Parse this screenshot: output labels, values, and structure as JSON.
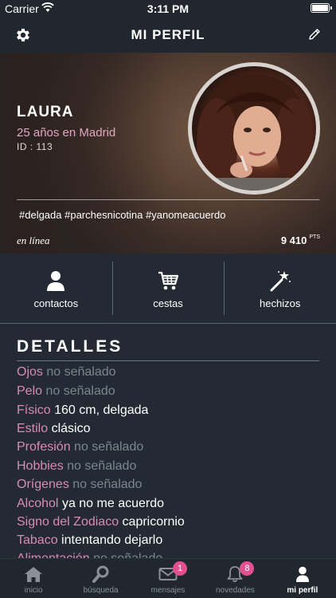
{
  "status_bar": {
    "carrier": "Carrier",
    "time": "3:11 PM"
  },
  "nav": {
    "title": "MI PERFIL",
    "left_icon": "gear-icon",
    "right_icon": "pencil-icon"
  },
  "profile": {
    "name": "LAURA",
    "age_city": "25 años en Madrid",
    "id_text": "ID : 113",
    "tags": "#delgada #parchesnicotina #yanomeacuerdo",
    "status": "en línea",
    "points": "9 410",
    "points_unit": "PTS"
  },
  "actions": [
    {
      "label": "contactos",
      "icon": "person-icon"
    },
    {
      "label": "cestas",
      "icon": "cart-icon"
    },
    {
      "label": "hechizos",
      "icon": "magic-wand-icon"
    }
  ],
  "details": {
    "heading": "DETALLES",
    "rows": [
      {
        "key": "Ojos",
        "value": "no señalado",
        "empty": true
      },
      {
        "key": "Pelo",
        "value": "no señalado",
        "empty": true
      },
      {
        "key": "Físico",
        "value": "160 cm, delgada",
        "empty": false
      },
      {
        "key": "Estilo",
        "value": "clásico",
        "empty": false
      },
      {
        "key": "Profesión",
        "value": "no señalado",
        "empty": true
      },
      {
        "key": "Hobbies",
        "value": "no señalado",
        "empty": true
      },
      {
        "key": "Orígenes",
        "value": "no señalado",
        "empty": true
      },
      {
        "key": "Alcohol",
        "value": "ya no me acuerdo",
        "empty": false
      },
      {
        "key": "Signo del Zodiaco",
        "value": "capricornio",
        "empty": false
      },
      {
        "key": "Tabaco",
        "value": "intentando dejarlo",
        "empty": false
      },
      {
        "key": "Alimentación",
        "value": "no señalado",
        "empty": true
      }
    ]
  },
  "tabs": [
    {
      "label": "inicio",
      "icon": "home-icon",
      "badge": ""
    },
    {
      "label": "búsqueda",
      "icon": "search-icon",
      "badge": ""
    },
    {
      "label": "mensajes",
      "icon": "envelope-icon",
      "badge": "1"
    },
    {
      "label": "novedades",
      "icon": "bell-icon",
      "badge": "8"
    },
    {
      "label": "mi perfil",
      "icon": "profile-icon",
      "badge": ""
    }
  ],
  "colors": {
    "accent_pink": "#d98ab7",
    "badge_pink": "#e2508f",
    "background": "#232a33"
  }
}
